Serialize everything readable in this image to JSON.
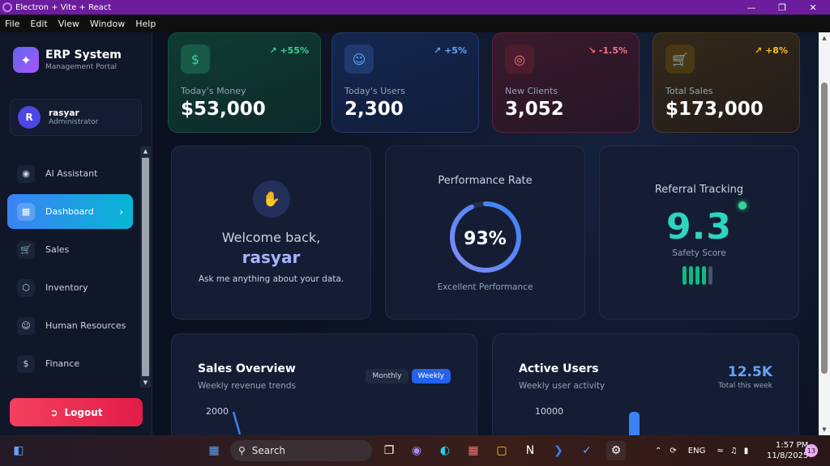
{
  "window": {
    "title": "Electron + Vite + React"
  },
  "menu": [
    "File",
    "Edit",
    "View",
    "Window",
    "Help"
  ],
  "brand": {
    "name": "ERP System",
    "subtitle": "Management Portal"
  },
  "user": {
    "initial": "R",
    "name": "rasyar",
    "role": "Administrator"
  },
  "nav": [
    {
      "label": "AI Assistant",
      "icon": "brain-icon"
    },
    {
      "label": "Dashboard",
      "icon": "grid-icon",
      "active": true
    },
    {
      "label": "Sales",
      "icon": "cart-icon"
    },
    {
      "label": "Inventory",
      "icon": "box-icon"
    },
    {
      "label": "Human Resources",
      "icon": "users-icon"
    },
    {
      "label": "Finance",
      "icon": "dollar-icon"
    }
  ],
  "logout": "Logout",
  "stats": [
    {
      "label": "Today's Money",
      "value": "$53,000",
      "delta": "+55%",
      "icon": "dollar-icon",
      "color": "#34d399"
    },
    {
      "label": "Today's Users",
      "value": "2,300",
      "delta": "+5%",
      "icon": "users-icon",
      "color": "#60a5fa"
    },
    {
      "label": "New Clients",
      "value": "3,052",
      "delta": "-1.5%",
      "icon": "target-icon",
      "color": "#fb7185"
    },
    {
      "label": "Total Sales",
      "value": "$173,000",
      "delta": "+8%",
      "icon": "cart-icon",
      "color": "#fbbf24"
    }
  ],
  "welcome": {
    "greeting": "Welcome back,",
    "name": "rasyar",
    "subtitle": "Ask me anything about your data."
  },
  "performance": {
    "title": "Performance Rate",
    "value": "93%",
    "percent": 93,
    "subtitle": "Excellent Performance"
  },
  "referral": {
    "title": "Referral Tracking",
    "score": "9.3",
    "subtitle": "Safety Score",
    "bars_on": 4,
    "bars_total": 5
  },
  "sales_overview": {
    "title": "Sales Overview",
    "subtitle": "Weekly revenue trends",
    "toggle": [
      "Monthly",
      "Weekly"
    ],
    "active_toggle": "Weekly",
    "ytick": "2000"
  },
  "active_users": {
    "title": "Active Users",
    "subtitle": "Weekly user activity",
    "total": "12.5K",
    "total_label": "Total this week",
    "ytick": "10000"
  },
  "taskbar": {
    "search": "Search",
    "lang": "ENG",
    "time": "1:57 PM",
    "date": "11/8/2025",
    "notifications": "13"
  }
}
